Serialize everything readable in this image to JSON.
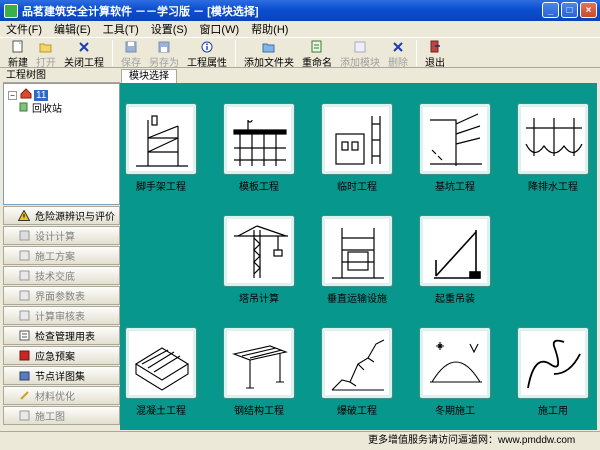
{
  "window": {
    "title": "品茗建筑安全计算软件 －－学习版 － [模块选择]"
  },
  "menu": [
    "文件(F)",
    "编辑(E)",
    "工具(T)",
    "设置(S)",
    "窗口(W)",
    "帮助(H)"
  ],
  "toolbar": [
    {
      "label": "新建",
      "icon": "new-file-icon",
      "enabled": true
    },
    {
      "label": "打开",
      "icon": "open-folder-icon",
      "enabled": false
    },
    {
      "label": "关闭工程",
      "icon": "close-icon",
      "enabled": true
    },
    {
      "label": "保存",
      "icon": "save-icon",
      "enabled": false
    },
    {
      "label": "另存为",
      "icon": "save-as-icon",
      "enabled": false
    },
    {
      "label": "工程属性",
      "icon": "info-icon",
      "enabled": true
    },
    {
      "label": "添加文件夹",
      "icon": "add-folder-icon",
      "enabled": true
    },
    {
      "label": "重命名",
      "icon": "rename-icon",
      "enabled": true
    },
    {
      "label": "添加模块",
      "icon": "add-module-icon",
      "enabled": false
    },
    {
      "label": "删除",
      "icon": "delete-icon",
      "enabled": false
    },
    {
      "label": "退出",
      "icon": "exit-icon",
      "enabled": true
    }
  ],
  "tree": {
    "header": "工程树图",
    "root_label": "11",
    "recycle_label": "回收站"
  },
  "left_buttons": [
    {
      "label": "危险源辨识与评价",
      "enabled": true,
      "icon": "warning-icon"
    },
    {
      "label": "设计计算",
      "enabled": false,
      "icon": "calculator-icon"
    },
    {
      "label": "施工方案",
      "enabled": false,
      "icon": "plan-icon"
    },
    {
      "label": "技术交底",
      "enabled": false,
      "icon": "handshake-icon"
    },
    {
      "label": "界面参数表",
      "enabled": false,
      "icon": "table-icon"
    },
    {
      "label": "计算审核表",
      "enabled": false,
      "icon": "review-icon"
    },
    {
      "label": "检查管理用表",
      "enabled": true,
      "icon": "checklist-icon"
    },
    {
      "label": "应急预案",
      "enabled": true,
      "icon": "book-icon"
    },
    {
      "label": "节点详图集",
      "enabled": true,
      "icon": "stack-icon"
    },
    {
      "label": "材料优化",
      "enabled": false,
      "icon": "pencil-icon"
    },
    {
      "label": "施工图",
      "enabled": false,
      "icon": "drawing-icon"
    }
  ],
  "main": {
    "tab_label": "模块选择",
    "modules": [
      {
        "label": "脚手架工程",
        "icon": "scaffold-icon"
      },
      {
        "label": "模板工程",
        "icon": "formwork-icon"
      },
      {
        "label": "临时工程",
        "icon": "temporary-works-icon"
      },
      {
        "label": "基坑工程",
        "icon": "foundation-pit-icon"
      },
      {
        "label": "降排水工程",
        "icon": "dewatering-icon"
      },
      {
        "label": "塔吊计算",
        "icon": "tower-crane-icon"
      },
      {
        "label": "垂直运输设施",
        "icon": "vertical-transport-icon"
      },
      {
        "label": "起重吊装",
        "icon": "hoisting-icon"
      },
      {
        "label": "混凝土工程",
        "icon": "concrete-icon"
      },
      {
        "label": "钢结构工程",
        "icon": "steel-structure-icon"
      },
      {
        "label": "爆破工程",
        "icon": "blasting-icon"
      },
      {
        "label": "冬期施工",
        "icon": "winter-construction-icon"
      },
      {
        "label": "施工用",
        "icon": "curve-icon"
      }
    ]
  },
  "status": {
    "text": "更多增值服务请访问逼道网：www.pmddw.com"
  },
  "colors": {
    "main_bg": "#08978c",
    "title_bar": "#0a4fd0",
    "selection": "#316ac5"
  }
}
